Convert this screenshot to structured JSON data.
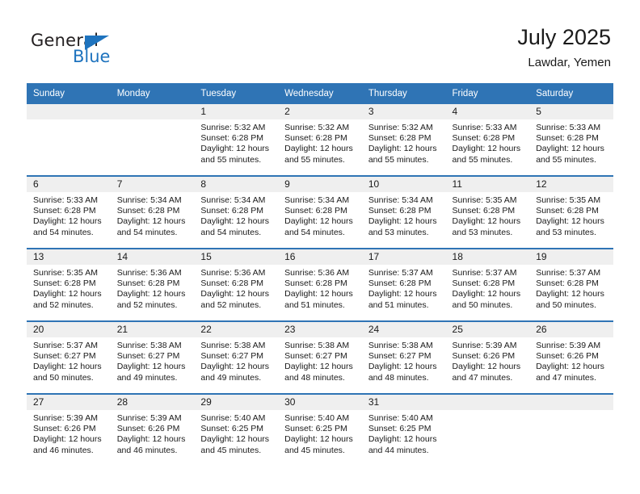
{
  "brand": {
    "name_part1": "General",
    "name_part2": "Blue",
    "accent_color": "#1e73be"
  },
  "header": {
    "title": "July 2025",
    "subtitle": "Lawdar, Yemen",
    "header_bg": "#2f74b5",
    "daynum_bg": "#efefef"
  },
  "weekdays": [
    "Sunday",
    "Monday",
    "Tuesday",
    "Wednesday",
    "Thursday",
    "Friday",
    "Saturday"
  ],
  "weeks": [
    [
      {
        "day": "",
        "sunrise": "",
        "sunset": "",
        "daylight_line1": "",
        "daylight_line2": ""
      },
      {
        "day": "",
        "sunrise": "",
        "sunset": "",
        "daylight_line1": "",
        "daylight_line2": ""
      },
      {
        "day": "1",
        "sunrise": "Sunrise: 5:32 AM",
        "sunset": "Sunset: 6:28 PM",
        "daylight_line1": "Daylight: 12 hours",
        "daylight_line2": "and 55 minutes."
      },
      {
        "day": "2",
        "sunrise": "Sunrise: 5:32 AM",
        "sunset": "Sunset: 6:28 PM",
        "daylight_line1": "Daylight: 12 hours",
        "daylight_line2": "and 55 minutes."
      },
      {
        "day": "3",
        "sunrise": "Sunrise: 5:32 AM",
        "sunset": "Sunset: 6:28 PM",
        "daylight_line1": "Daylight: 12 hours",
        "daylight_line2": "and 55 minutes."
      },
      {
        "day": "4",
        "sunrise": "Sunrise: 5:33 AM",
        "sunset": "Sunset: 6:28 PM",
        "daylight_line1": "Daylight: 12 hours",
        "daylight_line2": "and 55 minutes."
      },
      {
        "day": "5",
        "sunrise": "Sunrise: 5:33 AM",
        "sunset": "Sunset: 6:28 PM",
        "daylight_line1": "Daylight: 12 hours",
        "daylight_line2": "and 55 minutes."
      }
    ],
    [
      {
        "day": "6",
        "sunrise": "Sunrise: 5:33 AM",
        "sunset": "Sunset: 6:28 PM",
        "daylight_line1": "Daylight: 12 hours",
        "daylight_line2": "and 54 minutes."
      },
      {
        "day": "7",
        "sunrise": "Sunrise: 5:34 AM",
        "sunset": "Sunset: 6:28 PM",
        "daylight_line1": "Daylight: 12 hours",
        "daylight_line2": "and 54 minutes."
      },
      {
        "day": "8",
        "sunrise": "Sunrise: 5:34 AM",
        "sunset": "Sunset: 6:28 PM",
        "daylight_line1": "Daylight: 12 hours",
        "daylight_line2": "and 54 minutes."
      },
      {
        "day": "9",
        "sunrise": "Sunrise: 5:34 AM",
        "sunset": "Sunset: 6:28 PM",
        "daylight_line1": "Daylight: 12 hours",
        "daylight_line2": "and 54 minutes."
      },
      {
        "day": "10",
        "sunrise": "Sunrise: 5:34 AM",
        "sunset": "Sunset: 6:28 PM",
        "daylight_line1": "Daylight: 12 hours",
        "daylight_line2": "and 53 minutes."
      },
      {
        "day": "11",
        "sunrise": "Sunrise: 5:35 AM",
        "sunset": "Sunset: 6:28 PM",
        "daylight_line1": "Daylight: 12 hours",
        "daylight_line2": "and 53 minutes."
      },
      {
        "day": "12",
        "sunrise": "Sunrise: 5:35 AM",
        "sunset": "Sunset: 6:28 PM",
        "daylight_line1": "Daylight: 12 hours",
        "daylight_line2": "and 53 minutes."
      }
    ],
    [
      {
        "day": "13",
        "sunrise": "Sunrise: 5:35 AM",
        "sunset": "Sunset: 6:28 PM",
        "daylight_line1": "Daylight: 12 hours",
        "daylight_line2": "and 52 minutes."
      },
      {
        "day": "14",
        "sunrise": "Sunrise: 5:36 AM",
        "sunset": "Sunset: 6:28 PM",
        "daylight_line1": "Daylight: 12 hours",
        "daylight_line2": "and 52 minutes."
      },
      {
        "day": "15",
        "sunrise": "Sunrise: 5:36 AM",
        "sunset": "Sunset: 6:28 PM",
        "daylight_line1": "Daylight: 12 hours",
        "daylight_line2": "and 52 minutes."
      },
      {
        "day": "16",
        "sunrise": "Sunrise: 5:36 AM",
        "sunset": "Sunset: 6:28 PM",
        "daylight_line1": "Daylight: 12 hours",
        "daylight_line2": "and 51 minutes."
      },
      {
        "day": "17",
        "sunrise": "Sunrise: 5:37 AM",
        "sunset": "Sunset: 6:28 PM",
        "daylight_line1": "Daylight: 12 hours",
        "daylight_line2": "and 51 minutes."
      },
      {
        "day": "18",
        "sunrise": "Sunrise: 5:37 AM",
        "sunset": "Sunset: 6:28 PM",
        "daylight_line1": "Daylight: 12 hours",
        "daylight_line2": "and 50 minutes."
      },
      {
        "day": "19",
        "sunrise": "Sunrise: 5:37 AM",
        "sunset": "Sunset: 6:28 PM",
        "daylight_line1": "Daylight: 12 hours",
        "daylight_line2": "and 50 minutes."
      }
    ],
    [
      {
        "day": "20",
        "sunrise": "Sunrise: 5:37 AM",
        "sunset": "Sunset: 6:27 PM",
        "daylight_line1": "Daylight: 12 hours",
        "daylight_line2": "and 50 minutes."
      },
      {
        "day": "21",
        "sunrise": "Sunrise: 5:38 AM",
        "sunset": "Sunset: 6:27 PM",
        "daylight_line1": "Daylight: 12 hours",
        "daylight_line2": "and 49 minutes."
      },
      {
        "day": "22",
        "sunrise": "Sunrise: 5:38 AM",
        "sunset": "Sunset: 6:27 PM",
        "daylight_line1": "Daylight: 12 hours",
        "daylight_line2": "and 49 minutes."
      },
      {
        "day": "23",
        "sunrise": "Sunrise: 5:38 AM",
        "sunset": "Sunset: 6:27 PM",
        "daylight_line1": "Daylight: 12 hours",
        "daylight_line2": "and 48 minutes."
      },
      {
        "day": "24",
        "sunrise": "Sunrise: 5:38 AM",
        "sunset": "Sunset: 6:27 PM",
        "daylight_line1": "Daylight: 12 hours",
        "daylight_line2": "and 48 minutes."
      },
      {
        "day": "25",
        "sunrise": "Sunrise: 5:39 AM",
        "sunset": "Sunset: 6:26 PM",
        "daylight_line1": "Daylight: 12 hours",
        "daylight_line2": "and 47 minutes."
      },
      {
        "day": "26",
        "sunrise": "Sunrise: 5:39 AM",
        "sunset": "Sunset: 6:26 PM",
        "daylight_line1": "Daylight: 12 hours",
        "daylight_line2": "and 47 minutes."
      }
    ],
    [
      {
        "day": "27",
        "sunrise": "Sunrise: 5:39 AM",
        "sunset": "Sunset: 6:26 PM",
        "daylight_line1": "Daylight: 12 hours",
        "daylight_line2": "and 46 minutes."
      },
      {
        "day": "28",
        "sunrise": "Sunrise: 5:39 AM",
        "sunset": "Sunset: 6:26 PM",
        "daylight_line1": "Daylight: 12 hours",
        "daylight_line2": "and 46 minutes."
      },
      {
        "day": "29",
        "sunrise": "Sunrise: 5:40 AM",
        "sunset": "Sunset: 6:25 PM",
        "daylight_line1": "Daylight: 12 hours",
        "daylight_line2": "and 45 minutes."
      },
      {
        "day": "30",
        "sunrise": "Sunrise: 5:40 AM",
        "sunset": "Sunset: 6:25 PM",
        "daylight_line1": "Daylight: 12 hours",
        "daylight_line2": "and 45 minutes."
      },
      {
        "day": "31",
        "sunrise": "Sunrise: 5:40 AM",
        "sunset": "Sunset: 6:25 PM",
        "daylight_line1": "Daylight: 12 hours",
        "daylight_line2": "and 44 minutes."
      },
      {
        "day": "",
        "sunrise": "",
        "sunset": "",
        "daylight_line1": "",
        "daylight_line2": ""
      },
      {
        "day": "",
        "sunrise": "",
        "sunset": "",
        "daylight_line1": "",
        "daylight_line2": ""
      }
    ]
  ]
}
